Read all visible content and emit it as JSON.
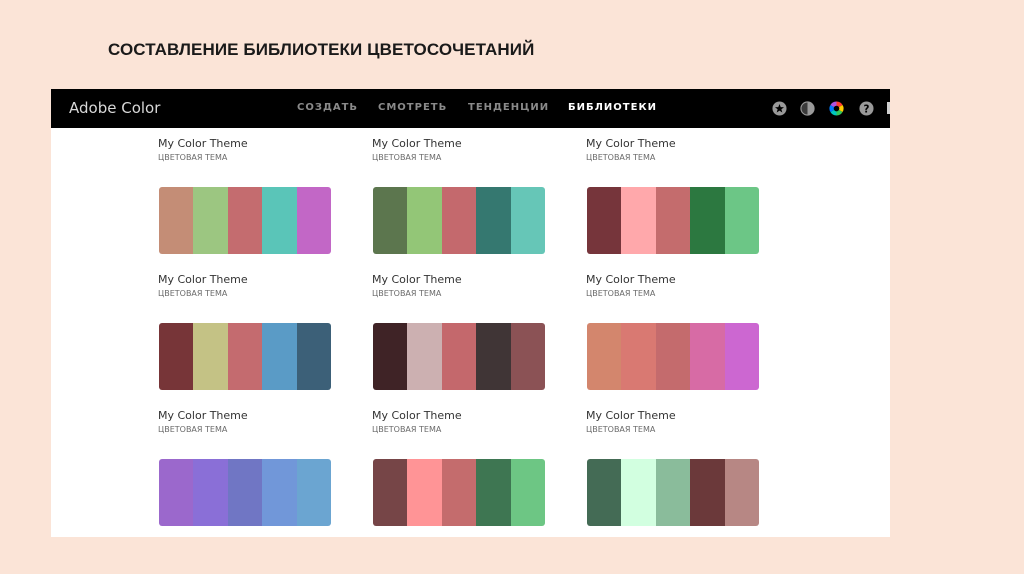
{
  "slide": {
    "title": "СОСТАВЛЕНИЕ БИБЛИОТЕКИ ЦВЕТОСОЧЕТАНИЙ"
  },
  "app": {
    "brand": "Adobe Color",
    "nav": [
      {
        "label": "СОЗДАТЬ",
        "active": false
      },
      {
        "label": "СМОТРЕТЬ",
        "active": false
      },
      {
        "label": "ТЕНДЕНЦИИ",
        "active": false
      },
      {
        "label": "БИБЛИОТЕКИ",
        "active": true
      }
    ],
    "icons": [
      "star-icon",
      "contrast-icon",
      "color-wheel-icon",
      "help-icon"
    ]
  },
  "themes": [
    {
      "name": "My Color Theme",
      "subtitle": "ЦВЕТОВАЯ ТЕМА",
      "colors": [
        "#c48d76",
        "#9cc681",
        "#c46c6f",
        "#5ac5b8",
        "#c267c6"
      ]
    },
    {
      "name": "My Color Theme",
      "subtitle": "ЦВЕТОВАЯ ТЕМА",
      "colors": [
        "#5c764e",
        "#93c677",
        "#c4696d",
        "#357870",
        "#66c6b7"
      ]
    },
    {
      "name": "My Color Theme",
      "subtitle": "ЦВЕТОВАЯ ТЕМА",
      "colors": [
        "#76353b",
        "#ffa8ab",
        "#c46c6d",
        "#2c7840",
        "#6cc686"
      ]
    },
    {
      "name": "My Color Theme",
      "subtitle": "ЦВЕТОВАЯ ТЕМА",
      "colors": [
        "#773538",
        "#c4c285",
        "#c46b6f",
        "#5a9bc6",
        "#3c6078"
      ]
    },
    {
      "name": "My Color Theme",
      "subtitle": "ЦВЕТОВАЯ ТЕМА",
      "colors": [
        "#3f2326",
        "#ccb0b1",
        "#c4686c",
        "#403536",
        "#8b5255"
      ]
    },
    {
      "name": "My Color Theme",
      "subtitle": "ЦВЕТОВАЯ ТЕМА",
      "colors": [
        "#d3866d",
        "#d97972",
        "#c46b6d",
        "#d76ba5",
        "#cc67d1"
      ]
    },
    {
      "name": "My Color Theme",
      "subtitle": "ЦВЕТОВАЯ ТЕМА",
      "colors": [
        "#9b68cc",
        "#8a6fd7",
        "#7076c4",
        "#7197d9",
        "#6ba5d1"
      ]
    },
    {
      "name": "My Color Theme",
      "subtitle": "ЦВЕТОВАЯ ТЕМА",
      "colors": [
        "#764547",
        "#ff9496",
        "#c46c6d",
        "#3e7652",
        "#6dc684"
      ]
    },
    {
      "name": "My Color Theme",
      "subtitle": "ЦВЕТОВАЯ ТЕМА",
      "colors": [
        "#446b55",
        "#d2ffe0",
        "#8abc9b",
        "#6b393a",
        "#b78784"
      ]
    }
  ]
}
